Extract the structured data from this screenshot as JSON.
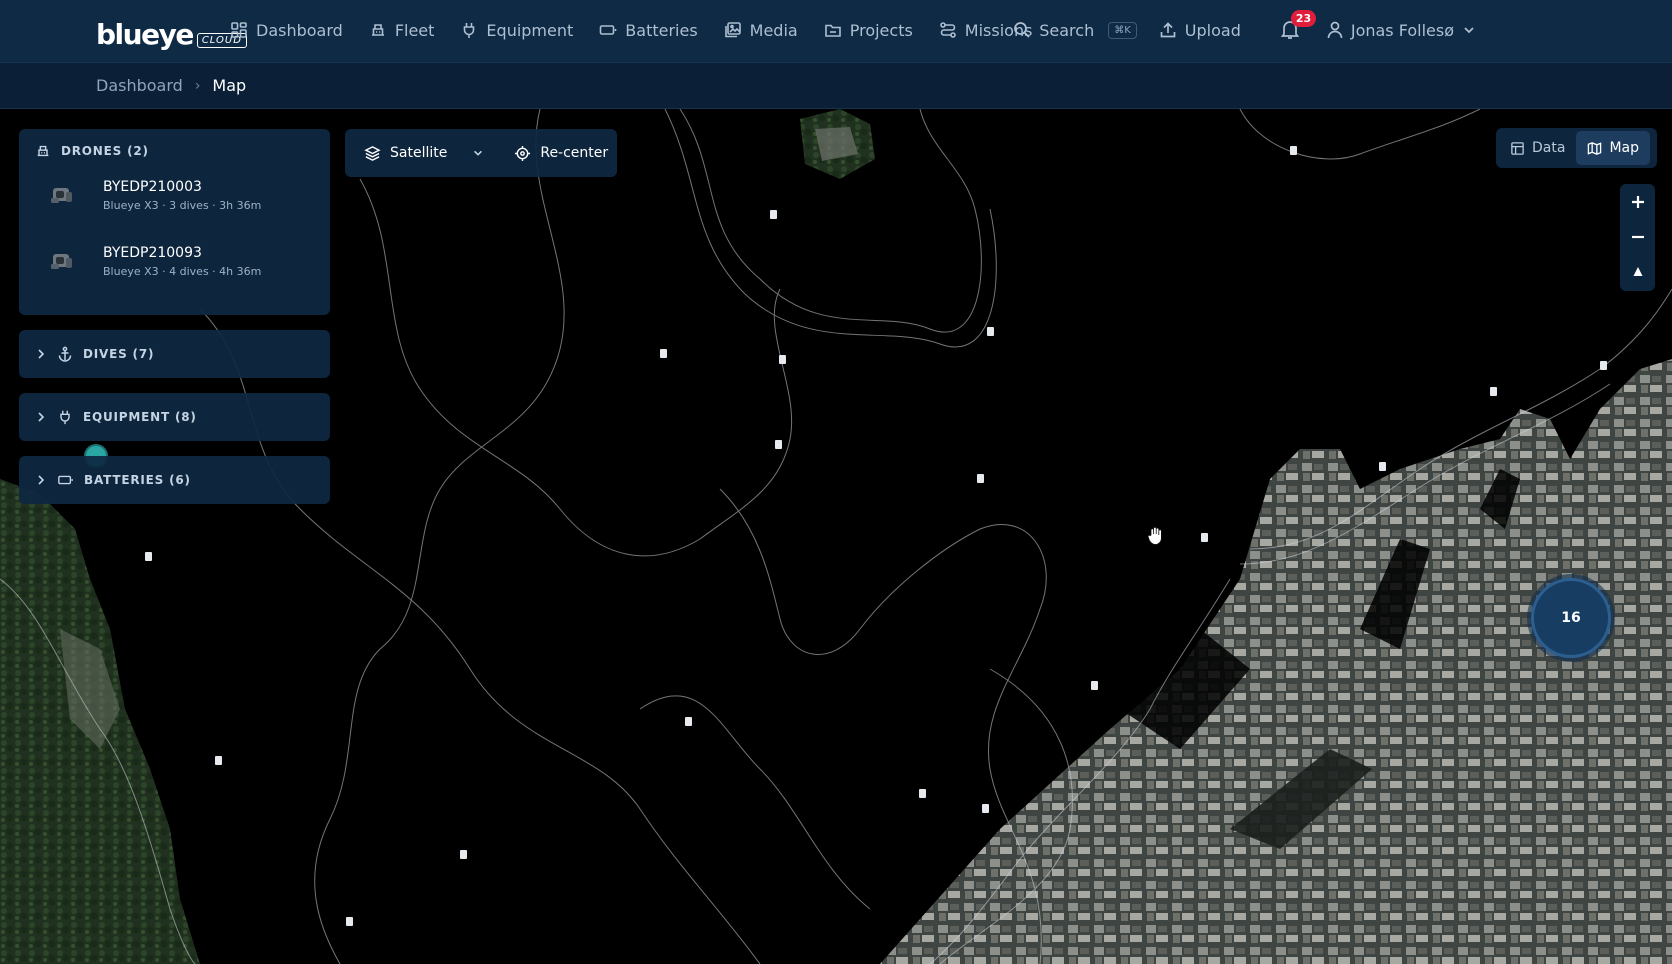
{
  "brand": {
    "name": "blueye",
    "suffix": "CLOUD"
  },
  "nav": {
    "items": [
      {
        "label": "Dashboard",
        "icon": "dashboard-icon"
      },
      {
        "label": "Fleet",
        "icon": "fleet-icon"
      },
      {
        "label": "Equipment",
        "icon": "plug-icon"
      },
      {
        "label": "Batteries",
        "icon": "battery-icon"
      },
      {
        "label": "Media",
        "icon": "media-icon"
      },
      {
        "label": "Projects",
        "icon": "folder-icon"
      },
      {
        "label": "Missions",
        "icon": "missions-icon"
      }
    ],
    "search_label": "Search",
    "search_shortcut": "⌘K",
    "upload_label": "Upload",
    "notification_count": "23",
    "user_name": "Jonas Follesø"
  },
  "breadcrumb": {
    "parent": "Dashboard",
    "current": "Map"
  },
  "sidebar": {
    "drones_title": "DRONES (2)",
    "drones": [
      {
        "name": "BYEDP210003",
        "meta": "Blueye X3 · 3 dives · 3h 36m"
      },
      {
        "name": "BYEDP210093",
        "meta": "Blueye X3 · 4 dives · 4h 36m"
      }
    ],
    "dives_title": "DIVES (7)",
    "equipment_title": "EQUIPMENT (8)",
    "batteries_title": "BATTERIES (6)"
  },
  "map_tools": {
    "layer_label": "Satellite",
    "recenter_label": "Re-center"
  },
  "view_toggle": {
    "data_label": "Data",
    "map_label": "Map",
    "active": "Map"
  },
  "cluster": {
    "count": "16"
  },
  "colors": {
    "topbar": "#0e2a44",
    "panel": "#0e2842",
    "badge": "#e11d3c",
    "cluster": "#173d63",
    "accent": "#2aa7a3"
  }
}
